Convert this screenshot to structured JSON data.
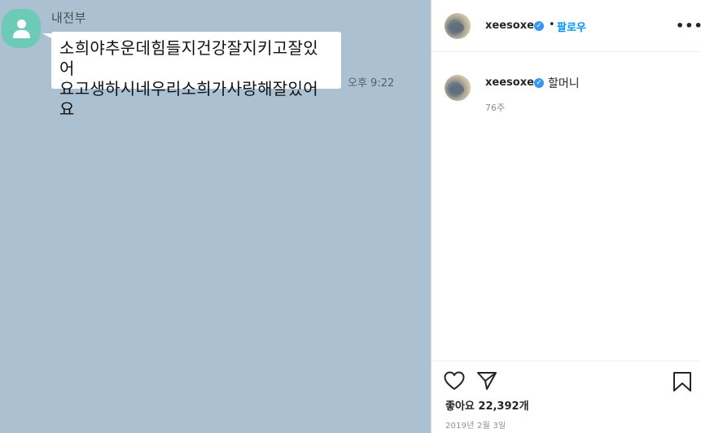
{
  "chat": {
    "sender_name": "내전부",
    "message_line1": "소희야추운데힘들지건강잘지키고잘있어",
    "message_line2": "요고생하시네우리소희가사랑해잘있어요",
    "timestamp": "오후 9:22"
  },
  "post": {
    "header": {
      "username": "xeesoxee",
      "verified_icon": "verified-badge-icon",
      "separator": "•",
      "follow_label": "팔로우",
      "more_label": "•••"
    },
    "comment": {
      "username": "xeesoxee",
      "text": "할머니",
      "age": "76주"
    },
    "likes_label": "좋아요 22,392개",
    "date": "2019년 2월 3일",
    "icons": [
      "heart-icon",
      "share-icon",
      "bookmark-icon"
    ]
  },
  "colors": {
    "chat_background": "#abc1d1",
    "avatar_teal": "#6ccab7",
    "follow_blue": "#0095f6",
    "verified_blue": "#3897f0"
  }
}
